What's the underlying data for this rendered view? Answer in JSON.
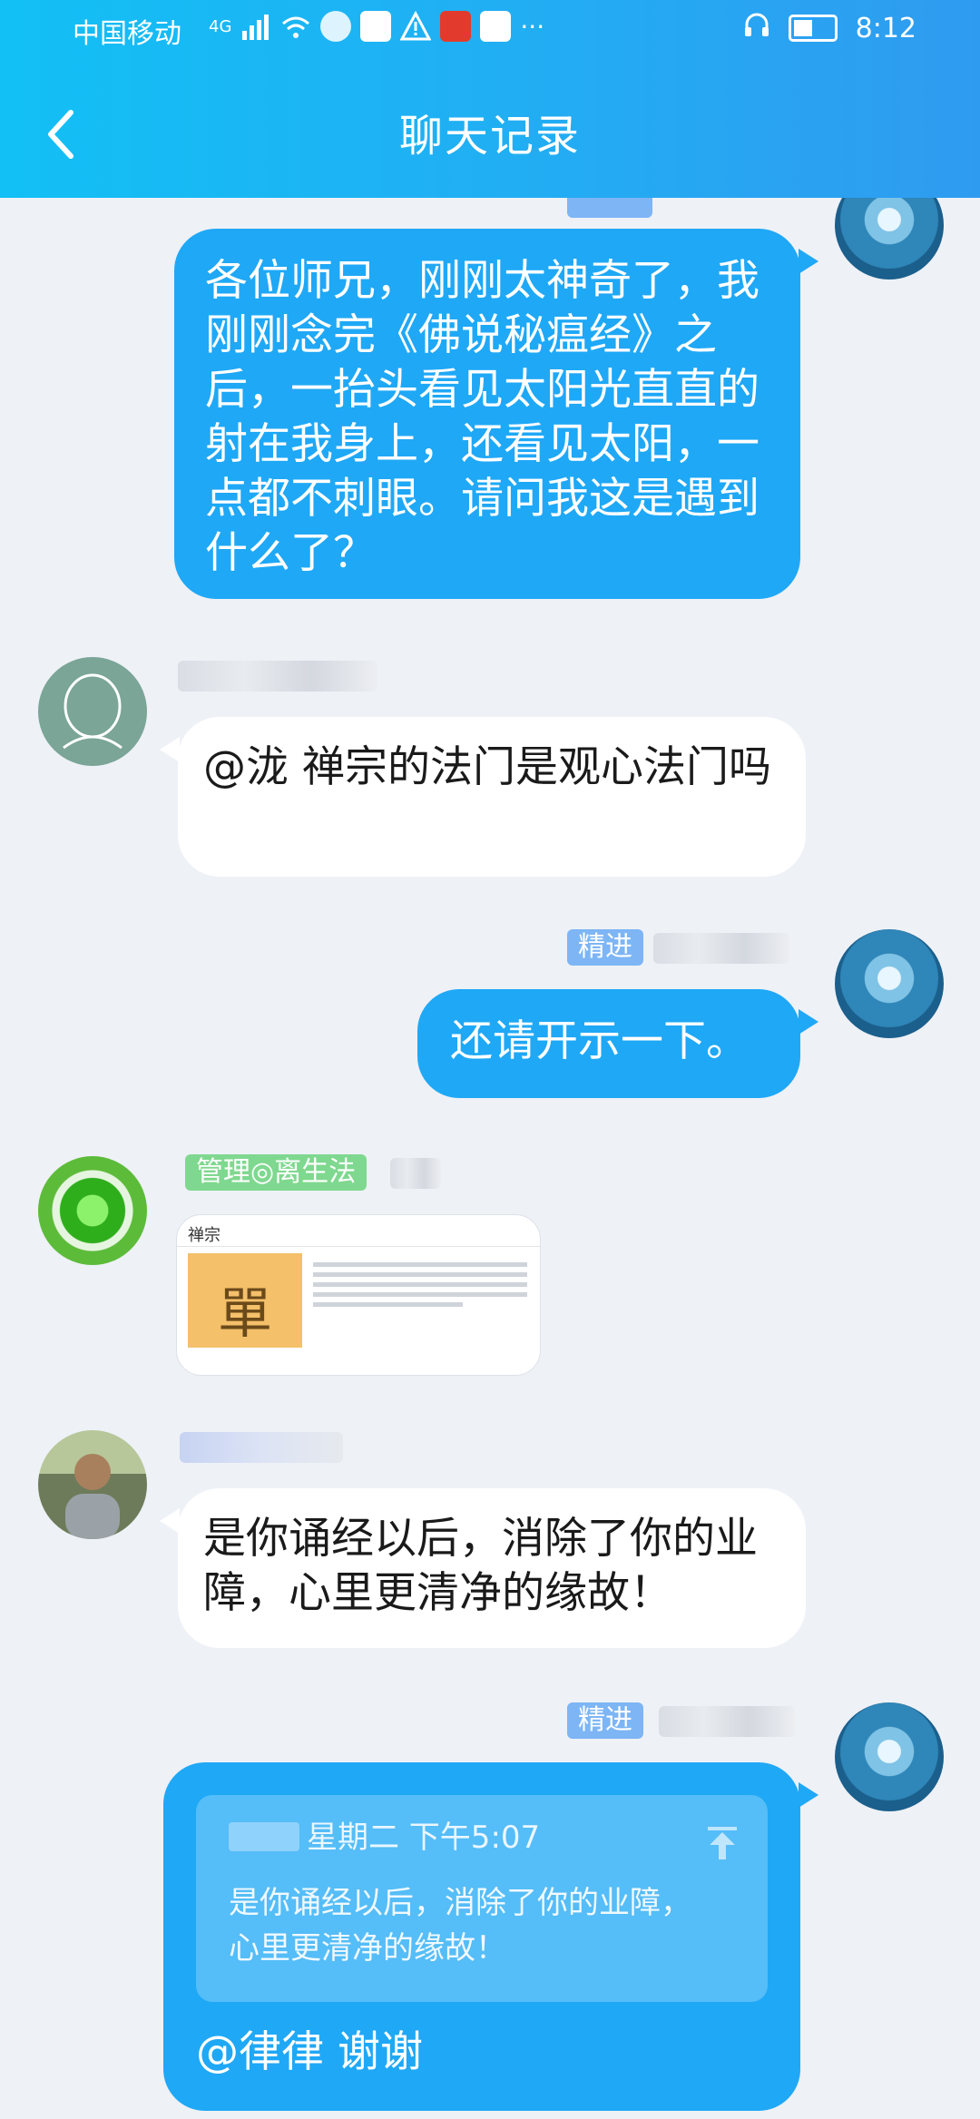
{
  "status_bar": {
    "carrier": "中国移动",
    "network": "4G",
    "time": "8:12"
  },
  "header": {
    "title": "聊天记录",
    "back_icon": "chevron-left-icon"
  },
  "messages": [
    {
      "direction": "out",
      "text": "各位师兄，刚刚太神奇了，我刚刚念完《佛说秘瘟经》之后，一抬头看见太阳光直直的射在我身上，还看见太阳，一点都不刺眼。请问我这是遇到什么了？"
    },
    {
      "direction": "in",
      "text": "@泷 禅宗的法门是观心法门吗"
    },
    {
      "direction": "out",
      "badge": "精进",
      "text": "还请开示一下。"
    },
    {
      "direction": "in",
      "badge": "管理◎离生法",
      "card": {
        "title": "禅宗",
        "image_glyph": "單"
      }
    },
    {
      "direction": "in",
      "text": "是你诵经以后，消除了你的业障，心里更清净的缘故！"
    },
    {
      "direction": "out",
      "badge": "精进",
      "quote": {
        "time": "星期二 下午5:07",
        "text": "是你诵经以后，消除了你的业障，心里更清净的缘故！"
      },
      "text": "@律律 谢谢"
    }
  ],
  "colors": {
    "header_bg": "#1fb4f4",
    "outgoing_bubble": "#1fa8f6",
    "incoming_bubble": "#ffffff",
    "badge_blue": "#7db5f5",
    "badge_green": "#7fd88f",
    "background": "#eef1f6"
  }
}
